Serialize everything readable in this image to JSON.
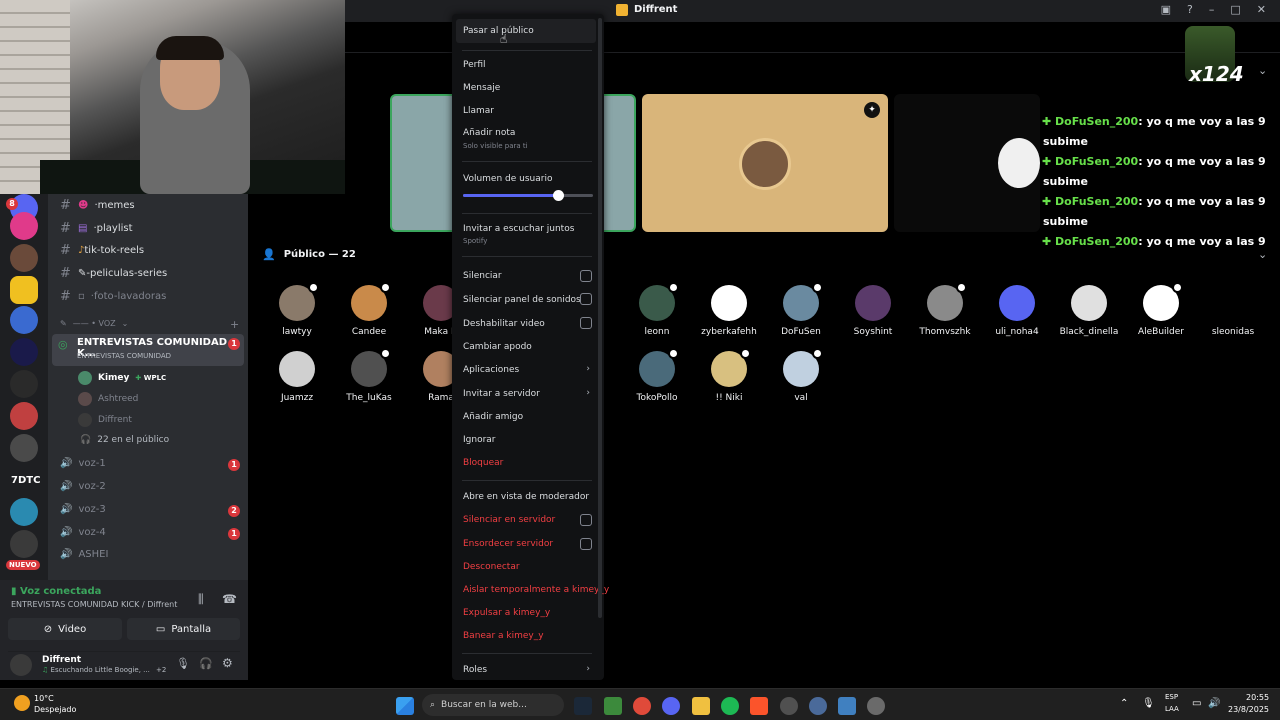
{
  "window": {
    "title": "Diffrent"
  },
  "gif_overlay": {
    "text": "x124"
  },
  "channels": {
    "text": [
      {
        "name": "memes",
        "prefix": "· ",
        "badge": "8"
      },
      {
        "name": "playlist",
        "prefix": "· ",
        "badge": ""
      },
      {
        "name": "tik-tok-reels",
        "prefix": "",
        "badge": ""
      },
      {
        "name": "-peliculas-series",
        "prefix": "",
        "badge": ""
      },
      {
        "name": "foto-lavadoras",
        "prefix": "· ",
        "badge": ""
      }
    ],
    "category": "—— • VOZ",
    "active_stage": {
      "name": "ENTREVISTAS COMUNIDAD K...",
      "topic": "ENTREVISTAS COMUNIDAD",
      "badge": "1"
    },
    "stage_members": [
      {
        "name": "Kimey",
        "tag": "WPLC"
      },
      {
        "name": "Ashtreed",
        "tag": ""
      },
      {
        "name": "Diffrent",
        "tag": ""
      }
    ],
    "audience_count": "22 en el público",
    "voice": [
      {
        "name": "voz-1",
        "badge": "1"
      },
      {
        "name": "voz-2",
        "badge": ""
      },
      {
        "name": "voz-3",
        "badge": "2"
      },
      {
        "name": "voz-4",
        "badge": "1"
      },
      {
        "name": "ASHEI",
        "badge": ""
      }
    ]
  },
  "servers": {
    "labels": [
      "7DTC",
      "NUEVO"
    ]
  },
  "voice_panel": {
    "status": "Voz conectada",
    "channel": "ENTREVISTAS COMUNIDAD KICK / Diffrent",
    "video_label": "Video",
    "screen_label": "Pantalla"
  },
  "user_panel": {
    "name": "Diffrent",
    "status": "Escuchando Little Boogie, ...",
    "extra": "+2"
  },
  "stage": {
    "audience_header": "Público — 22",
    "audience": [
      {
        "name": "lawtyy",
        "color": "#8a7a6a"
      },
      {
        "name": "Candee",
        "color": "#c98a4a"
      },
      {
        "name": "Maka N",
        "color": "#6a3a4a"
      },
      {
        "name": "leonn",
        "color": "#3a5a4a"
      },
      {
        "name": "zyberkafehh",
        "color": "#ffffff"
      },
      {
        "name": "DoFuSen",
        "color": "#6a8aa0"
      },
      {
        "name": "Soyshint",
        "color": "#5a3a6a"
      },
      {
        "name": "Thomvszhk",
        "color": "#8a8a8a"
      },
      {
        "name": "uli_noha4",
        "color": "#5865f2"
      },
      {
        "name": "Black_dinella",
        "color": "#e0e0e0"
      },
      {
        "name": "AleBuilder",
        "color": "#ffffff"
      },
      {
        "name": "sleonidas",
        "color": "#000000"
      },
      {
        "name": "Juamzz",
        "color": "#d0d0d0"
      },
      {
        "name": "The_luKas",
        "color": "#505050"
      },
      {
        "name": "Rama",
        "color": "#b08060"
      },
      {
        "name": "TokoPollo",
        "color": "#4a6a7a"
      },
      {
        "name": "!! Niki",
        "color": "#d8c080"
      },
      {
        "name": "val",
        "color": "#c0d0e0"
      }
    ]
  },
  "chat": {
    "lines": [
      {
        "user": "DoFuSen_200",
        "msg": ": yo q me voy a las 9"
      },
      {
        "user": "",
        "msg": "subime"
      },
      {
        "user": "DoFuSen_200",
        "msg": ": yo q me voy a las 9"
      },
      {
        "user": "",
        "msg": "subime"
      },
      {
        "user": "DoFuSen_200",
        "msg": ": yo q me voy a las 9"
      },
      {
        "user": "",
        "msg": "subime"
      },
      {
        "user": "DoFuSen_200",
        "msg": ": yo q me voy a las 9"
      }
    ]
  },
  "context_menu": {
    "items": {
      "move_to_audience": "Pasar al público",
      "profile": "Perfil",
      "message": "Mensaje",
      "call": "Llamar",
      "add_note": "Añadir nota",
      "note_hint": "Solo visible para ti",
      "user_volume": "Volumen de usuario",
      "listen_along": "Invitar a escuchar juntos",
      "spotify": "Spotify",
      "mute": "Silenciar",
      "mute_soundboard": "Silenciar panel de sonidos",
      "disable_video": "Deshabilitar video",
      "change_nick": "Cambiar apodo",
      "apps": "Aplicaciones",
      "invite_server": "Invitar a servidor",
      "add_friend": "Añadir amigo",
      "ignore": "Ignorar",
      "block": "Bloquear",
      "mod_view": "Abre en vista de moderador",
      "server_mute": "Silenciar en servidor",
      "server_deafen": "Ensordecer servidor",
      "disconnect": "Desconectar",
      "timeout": "Aislar temporalmente a kimey_y",
      "kick": "Expulsar a kimey_y",
      "ban": "Banear a kimey_y",
      "roles": "Roles"
    },
    "volume_level": 0.73
  },
  "taskbar": {
    "weather_temp": "10°C",
    "weather_desc": "Despejado",
    "search_placeholder": "Buscar en la web...",
    "lang": "ESP",
    "layout": "LAA",
    "time": "20:55",
    "date": "23/8/2025"
  }
}
